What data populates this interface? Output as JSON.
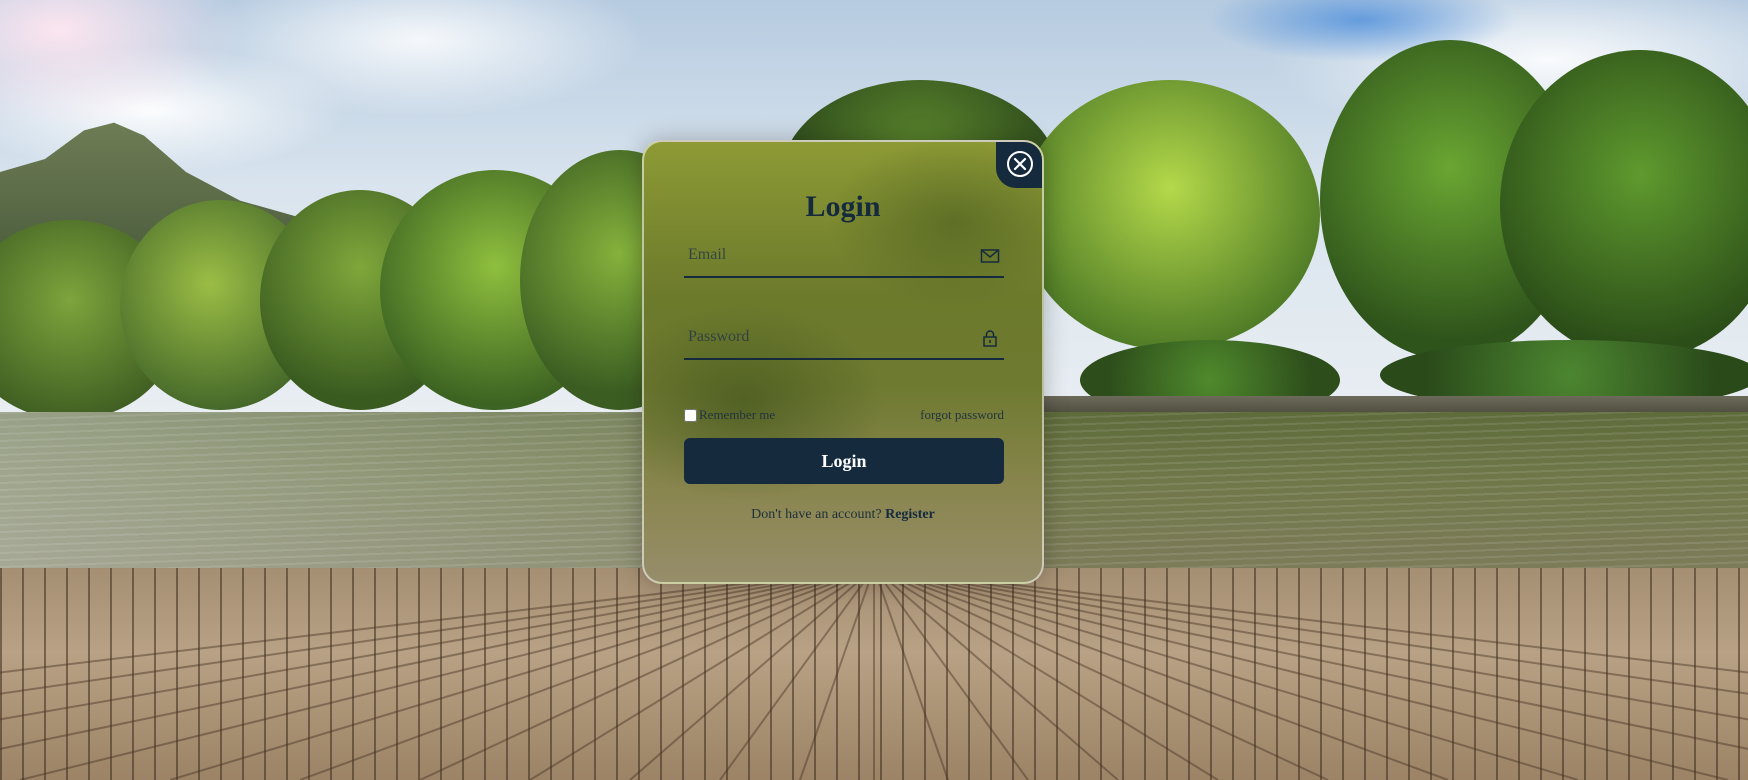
{
  "login_card": {
    "title": "Login",
    "close_icon": "close-icon",
    "email": {
      "value": "",
      "placeholder": "Email",
      "icon": "mail-icon"
    },
    "password": {
      "value": "",
      "placeholder": "Password",
      "icon": "lock-icon"
    },
    "remember_label": "Remember me",
    "remember_checked": false,
    "forgot_label": "forgot password",
    "submit_label": "Login",
    "register_prompt": "Don't have an account?",
    "register_label": "Register"
  },
  "colors": {
    "primary": "#162a3e",
    "button_text": "#ffffff"
  }
}
